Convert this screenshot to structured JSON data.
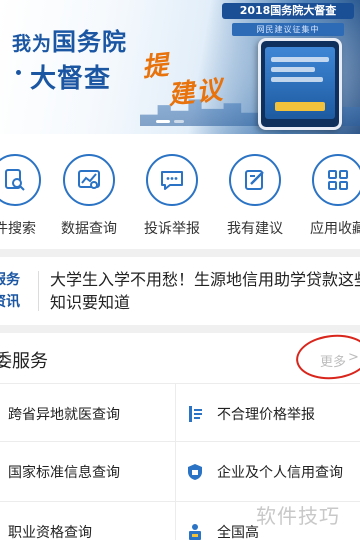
{
  "banner": {
    "line1_main": "我为",
    "line1_rest": "国务院",
    "line2": "大督查",
    "suggest_a": "提",
    "suggest_b": "建议",
    "badge_year": "2018国务院大督查",
    "badge_sub": "网民建议征集中"
  },
  "shortcuts": [
    {
      "label": "件搜索",
      "icon": "file-search-icon"
    },
    {
      "label": "数据查询",
      "icon": "data-chart-icon"
    },
    {
      "label": "投诉举报",
      "icon": "complaint-chat-icon"
    },
    {
      "label": "我有建议",
      "icon": "edit-suggestion-icon"
    },
    {
      "label": "应用收藏",
      "icon": "apps-grid-icon"
    }
  ],
  "news": {
    "badge_line1": "服务",
    "badge_line2": "资讯",
    "headline": "大学生入学不用愁！生源地信用助学贷款这些知识要知道"
  },
  "section": {
    "title": "委服务",
    "more": "更多",
    "more_chevron": ">"
  },
  "services": [
    {
      "label": "跨省异地就医查询",
      "icon": "none"
    },
    {
      "label": "不合理价格举报",
      "icon": "price-report-icon"
    },
    {
      "label": "国家标准信息查询",
      "icon": "none"
    },
    {
      "label": "企业及个人信用查询",
      "icon": "credit-shield-icon"
    },
    {
      "label": "职业资格查询",
      "icon": "none"
    },
    {
      "label": "全国高",
      "icon": "education-icon"
    }
  ],
  "watermark": "软件技巧",
  "colors": {
    "brand_blue": "#1b56a3",
    "icon_blue": "#2b73c4",
    "accent_orange": "#e8720c",
    "highlight_red": "#d9261c"
  }
}
